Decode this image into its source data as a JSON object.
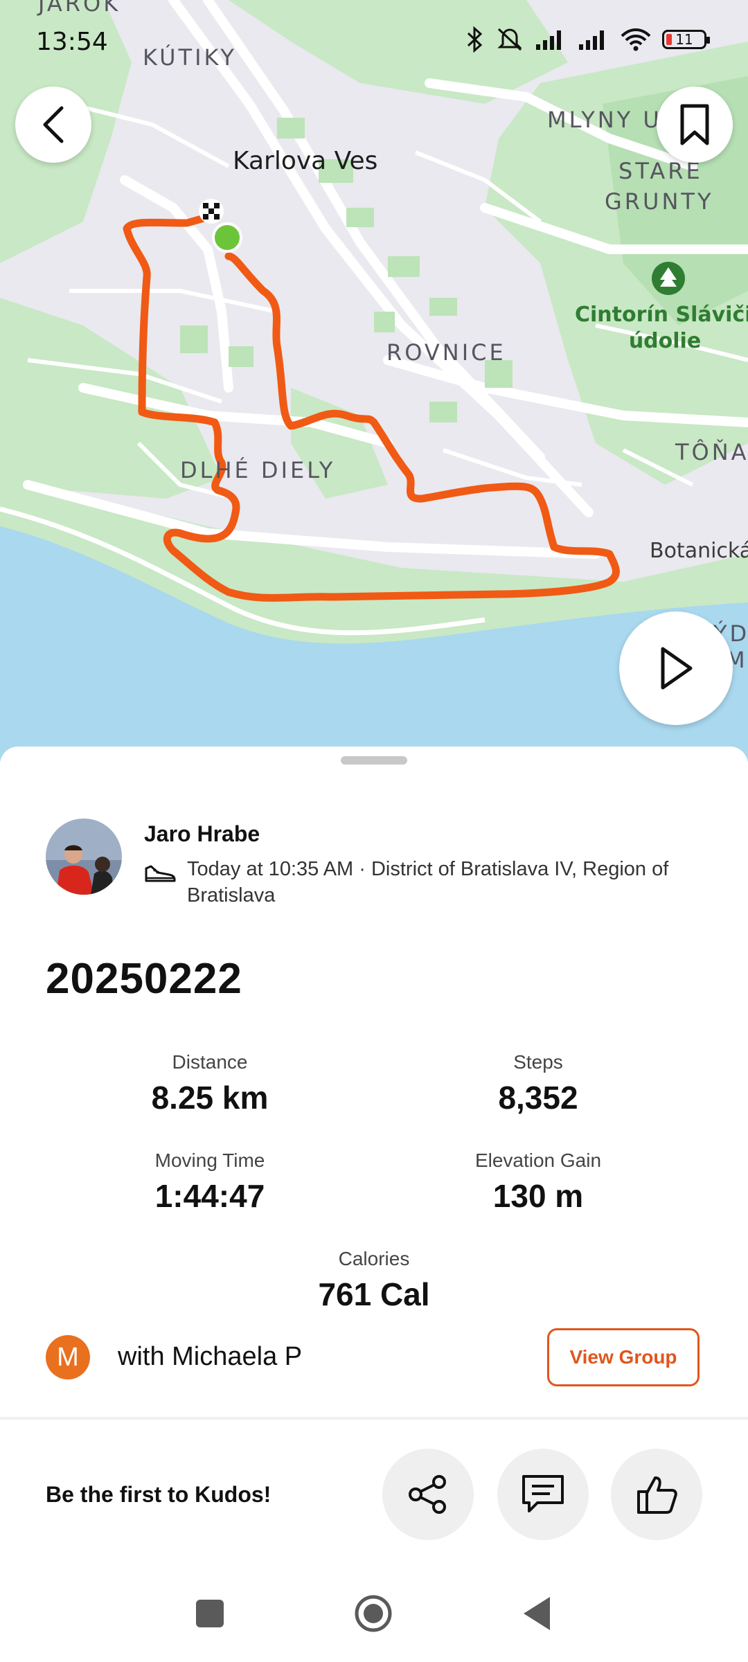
{
  "status_bar": {
    "time": "13:54",
    "battery": "11"
  },
  "map": {
    "labels": {
      "jarok": "JAROK",
      "kutiky": "KÚTIKY",
      "karlova_ves": "Karlova Ves",
      "mlyny": "MLYNY U",
      "stare": "STARÉ",
      "grunty": "GRUNTY",
      "cintorin_1": "Cintorín Slávičie",
      "cintorin_2": "údolie",
      "rovnice": "ROVNICE",
      "tona": "TÔŇA",
      "dlhe_diely": "DLHÉ DIELY",
      "botanicka": "Botanická",
      "ds": "ÝDS",
      "m": "M"
    },
    "colors": {
      "route": "#f05a14",
      "start": "#6cc43a",
      "river": "#a9d8ef",
      "green": "#c6e7c2"
    }
  },
  "buttons": {
    "back": "back",
    "bookmark": "bookmark",
    "play": "play"
  },
  "activity": {
    "athlete": "Jaro Hrabe",
    "meta": "Today at 10:35 AM · District of Bratislava IV, Region of Bratislava",
    "title": "20250222",
    "stats": {
      "distance_label": "Distance",
      "distance_value": "8.25 km",
      "steps_label": "Steps",
      "steps_value": "8,352",
      "moving_label": "Moving Time",
      "moving_value": "1:44:47",
      "elev_label": "Elevation Gain",
      "elev_value": "130 m",
      "calories_label": "Calories",
      "calories_value": "761 Cal"
    },
    "group": {
      "initial": "M",
      "text": "with Michaela P",
      "button": "View Group"
    }
  },
  "kudos": {
    "prompt": "Be the first to Kudos!"
  },
  "accent_color": "#e0561c"
}
